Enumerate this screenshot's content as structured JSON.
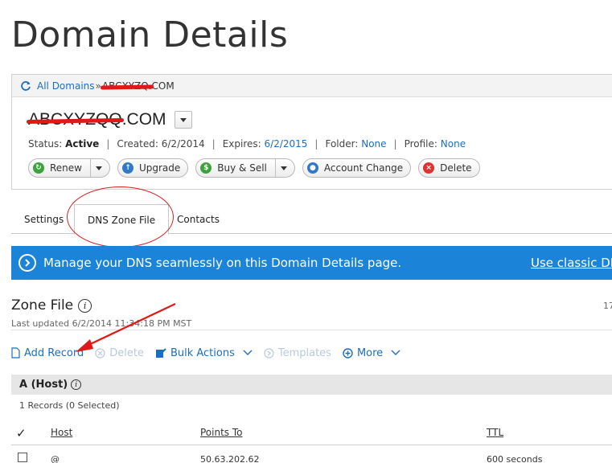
{
  "page_title": "Domain Details",
  "breadcrumb": {
    "root_label": "All Domains",
    "separator": "»",
    "current_suffix": "COM"
  },
  "domain": {
    "name_suffix": ".COM",
    "redacted_prefix": "ABCXYZQQ"
  },
  "meta": {
    "status_label": "Status:",
    "status_value": "Active",
    "created_label": "Created:",
    "created_value": "6/2/2014",
    "expires_label": "Expires:",
    "expires_value": "6/2/2015",
    "folder_label": "Folder:",
    "folder_value": "None",
    "profile_label": "Profile:",
    "profile_value": "None"
  },
  "actions": {
    "renew": "Renew",
    "upgrade": "Upgrade",
    "buy_sell": "Buy & Sell",
    "account_change": "Account Change",
    "delete": "Delete"
  },
  "tabs": [
    {
      "label": "Settings"
    },
    {
      "label": "DNS Zone File"
    },
    {
      "label": "Contacts"
    }
  ],
  "banner": {
    "message": "Manage your DNS seamlessly on this Domain Details page.",
    "link": "Use classic DNS"
  },
  "zone": {
    "title": "Zone File",
    "last_updated": "Last updated 6/2/2014 11:34:18 PM MST",
    "count_fragment": "17"
  },
  "toolbar": {
    "add_record": "Add Record",
    "delete": "Delete",
    "bulk_actions": "Bulk Actions",
    "templates": "Templates",
    "more": "More"
  },
  "section": {
    "title": "A (Host)",
    "records_count": "1 Records (0 Selected)"
  },
  "table": {
    "headers": {
      "host": "Host",
      "points_to": "Points To",
      "ttl": "TTL"
    },
    "rows": [
      {
        "host": "@",
        "points_to": "50.63.202.62",
        "ttl": "600 seconds"
      }
    ]
  },
  "colors": {
    "accent_blue": "#1a6fc2",
    "banner_blue": "#1b84d8",
    "annotation_red": "#d42020"
  }
}
